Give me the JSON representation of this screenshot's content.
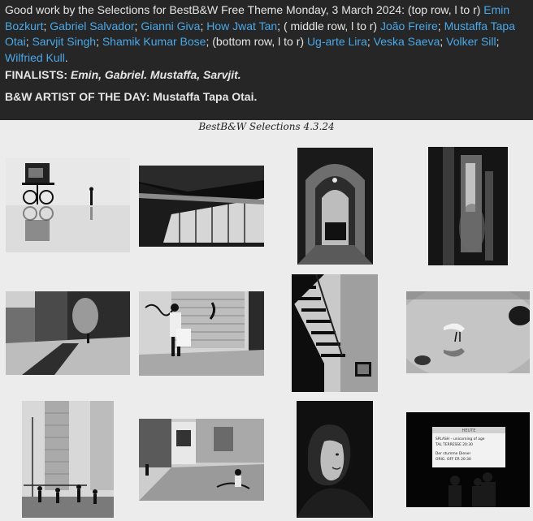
{
  "post": {
    "intro_text": "Good work by the Selections for BestB&W Free Theme Monday, 3 March 2024: (top row, l to r)",
    "top_row": [
      "Emin Bozkurt",
      "Gabriel Salvador",
      "Gianni Giva",
      "How Jwat Tan"
    ],
    "middle_row_label": "( middle row, l to r)",
    "middle_row": [
      "João Freire",
      "Mustaffa Tapa Otai",
      "Sarvjit Singh",
      "Shamik Kumar Bose"
    ],
    "bottom_row_label": "(bottom row, l to r)",
    "bottom_row": [
      "Ug-arte Lira",
      "Veska Saeva",
      "Volker Sill",
      "Wilfried Kull"
    ],
    "finalists_label": "FINALISTS:",
    "finalists_names": "Emin, Gabriel. Mustaffa, Sarvjit.",
    "artist_label": "B&W ARTIST OF THE DAY:",
    "artist_name": "Mustaffa Tapa Otai."
  },
  "board": {
    "title": "BestB&W Selections 4.3.24",
    "screen_text": {
      "header": "HEUTE",
      "line1": "SPLASH – unicorning of age",
      "line2": "TAL TERRESSE 20:30",
      "line3": "Der stumme Diener",
      "line4": "ORIG. OFF ER 20:30"
    }
  }
}
